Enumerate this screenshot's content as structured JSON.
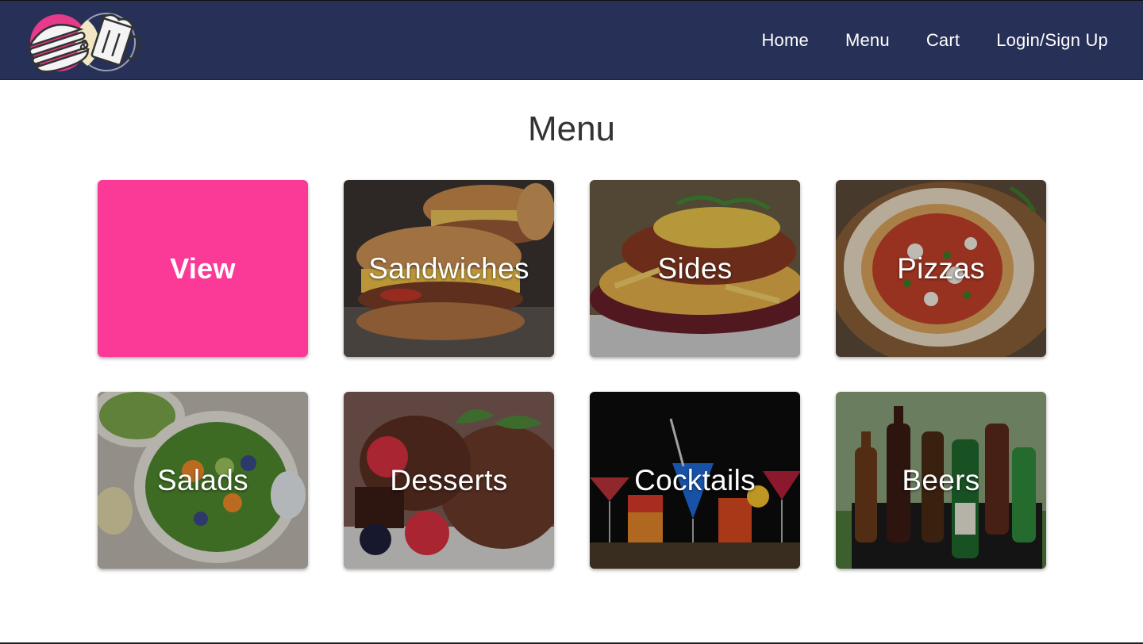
{
  "brand": {
    "logo_icon": "burger-and-beer-logo"
  },
  "nav": {
    "items": [
      {
        "label": "Home"
      },
      {
        "label": "Menu"
      },
      {
        "label": "Cart"
      },
      {
        "label": "Login/Sign Up"
      }
    ]
  },
  "page": {
    "title": "Menu"
  },
  "cards": [
    {
      "label": "View",
      "accent": "#fb3a97"
    },
    {
      "label": "Sandwiches"
    },
    {
      "label": "Sides"
    },
    {
      "label": "Pizzas"
    },
    {
      "label": "Salads"
    },
    {
      "label": "Desserts"
    },
    {
      "label": "Cocktails"
    },
    {
      "label": "Beers"
    }
  ],
  "colors": {
    "navbar": "#273057",
    "accent": "#fb3a97",
    "title": "#333333"
  }
}
